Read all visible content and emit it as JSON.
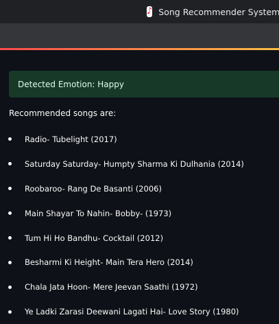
{
  "browser": {
    "tab_title": "Song Recommender System",
    "tab_icon": "music-note-icon"
  },
  "app": {
    "alert_text": "Detected Emotion: Happy",
    "recommend_heading": "Recommended songs are:",
    "songs": [
      "Radio- Tubelight (2017)",
      "Saturday Saturday- Humpty Sharma Ki Dulhania (2014)",
      "Roobaroo- Rang De Basanti (2006)",
      "Main Shayar To Nahin- Bobby- (1973)",
      "Tum Hi Ho Bandhu- Cocktail (2012)",
      "Besharmi Ki Height- Main Tera Hero (2014)",
      "Chala Jata Hoon- Mere Jeevan Saathi (1972)",
      "Ye Ladki Zarasi Deewani Lagati Hai- Love Story (1980)"
    ]
  },
  "colors": {
    "background": "#0e1117",
    "success_bg": "#173928",
    "success_text": "#dffde9",
    "accent_red": "#ff4b4b",
    "accent_yellow": "#ffbd45"
  }
}
